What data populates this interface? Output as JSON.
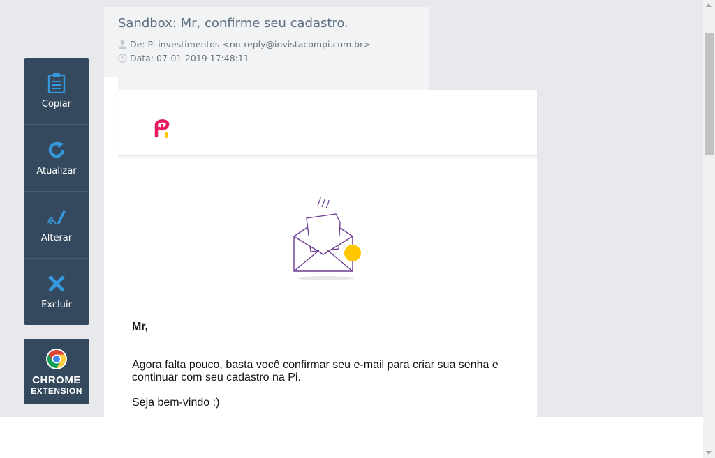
{
  "email": {
    "subject": "Sandbox: Mr, confirme seu cadastro.",
    "from": "De: Pi investimentos <no-reply@invistacompi.com.br>",
    "date": "Data: 07-01-2019 17:48:11"
  },
  "actions": [
    {
      "label": "Copiar",
      "icon": "clipboard-icon"
    },
    {
      "label": "Atualizar",
      "icon": "refresh-icon"
    },
    {
      "label": "Alterar",
      "icon": "edit-pen-icon"
    },
    {
      "label": "Excluir",
      "icon": "close-x-icon"
    }
  ],
  "chrome_extension": {
    "line1": "CHROME",
    "line2": "EXTENSION"
  },
  "body": {
    "greeting": "Mr,",
    "paragraph": "Agora falta pouco, basta você confirmar seu e-mail para criar sua senha e continuar com seu cadastro na Pi.",
    "closing": "Seja bem-vindo :)"
  },
  "colors": {
    "panel": "#34495e",
    "icon_blue": "#3498db",
    "brand_pink": "#e8195f",
    "brand_yellow": "#ffc700",
    "envelope_purple": "#6b3a91"
  }
}
